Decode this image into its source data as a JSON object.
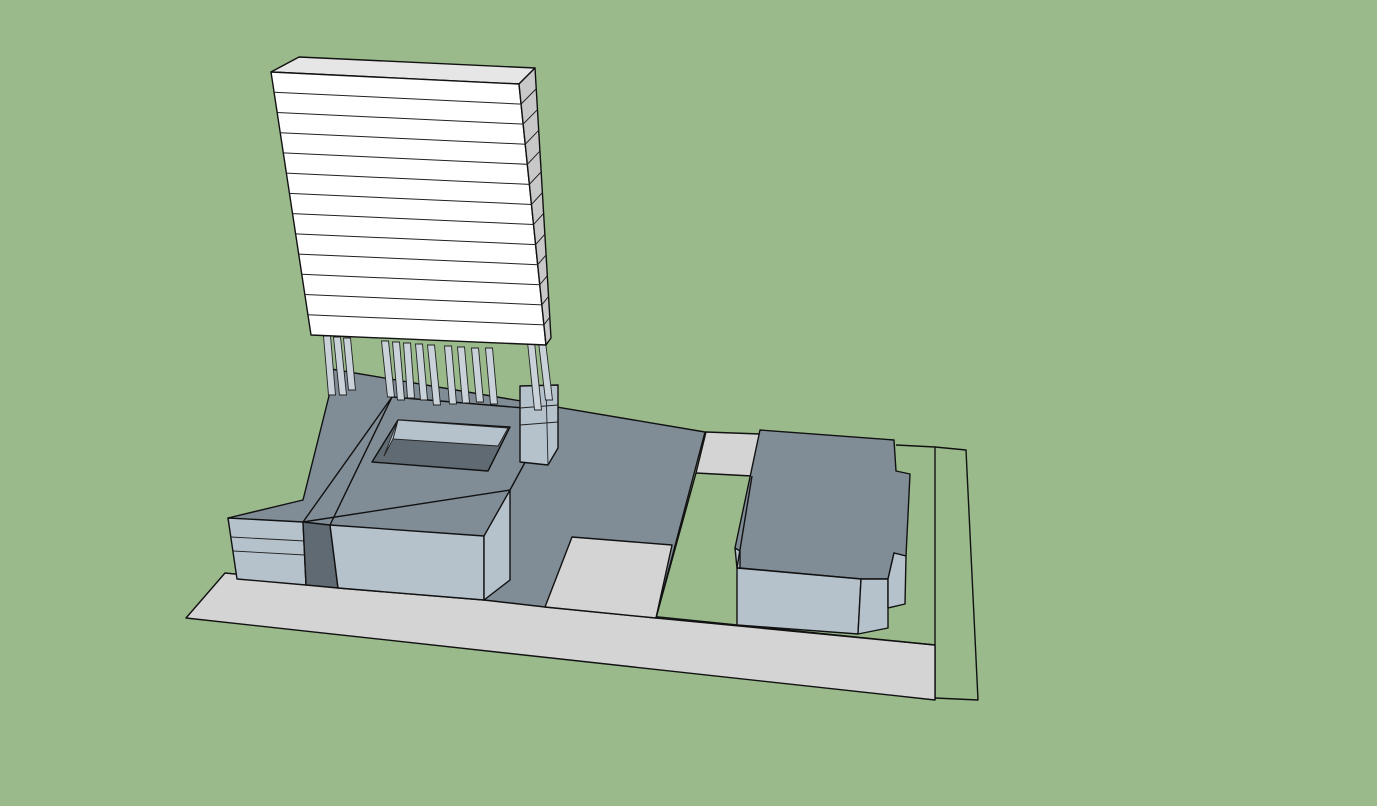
{
  "colors": {
    "ground": "#9aba8c",
    "roof": "#808d96",
    "wall": "#b5c2cc",
    "wall_shadow": "#5f6a72",
    "paving": "#d4d4d4",
    "tower_face": "#ffffff",
    "tower_side": "#c8c8c8",
    "tower_top": "#e6e6e6",
    "edge": "#111111"
  },
  "icons": {
    "model": "3d-massing-model"
  }
}
